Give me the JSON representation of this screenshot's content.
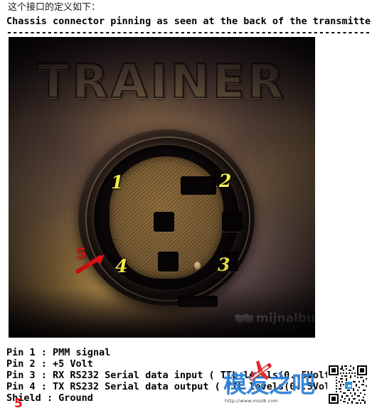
{
  "intro": {
    "text": "这个接口的定义如下："
  },
  "header": {
    "title": "Chassis connector pinning as seen at the back of the transmitter",
    "rule": "----------------------------------------------------------------------"
  },
  "photo": {
    "alt_name": "trainer-din-connector-photo",
    "embossed_label": "TRAINER",
    "watermark": "mijnalbum.nl",
    "pin_markers": [
      {
        "id": "1",
        "label": "1",
        "color": "#f5ee4b"
      },
      {
        "id": "2",
        "label": "2",
        "color": "#f5ee4b"
      },
      {
        "id": "3",
        "label": "3",
        "color": "#f5ee4b"
      },
      {
        "id": "4",
        "label": "4",
        "color": "#f5ee4b"
      },
      {
        "id": "5",
        "label": "5",
        "color": "#ee1111"
      }
    ]
  },
  "pinout": {
    "lines": [
      "Pin 1 : PMM signal",
      "Pin 2 : +5 Volt",
      "Pin 3 : RX RS232 Serial data input ( TTL levels(0..5Volt",
      "Pin 4 : TX RS232 Serial data output ( TTL levels(0..5Vol",
      "Shield : Ground"
    ]
  },
  "annotation": {
    "red_five": "5"
  },
  "watermark": {
    "brand_cn": "模友之吧",
    "url": "http://www.moz8.com",
    "brand_color": "#2b7fd4",
    "plane_color": "#e03030"
  }
}
